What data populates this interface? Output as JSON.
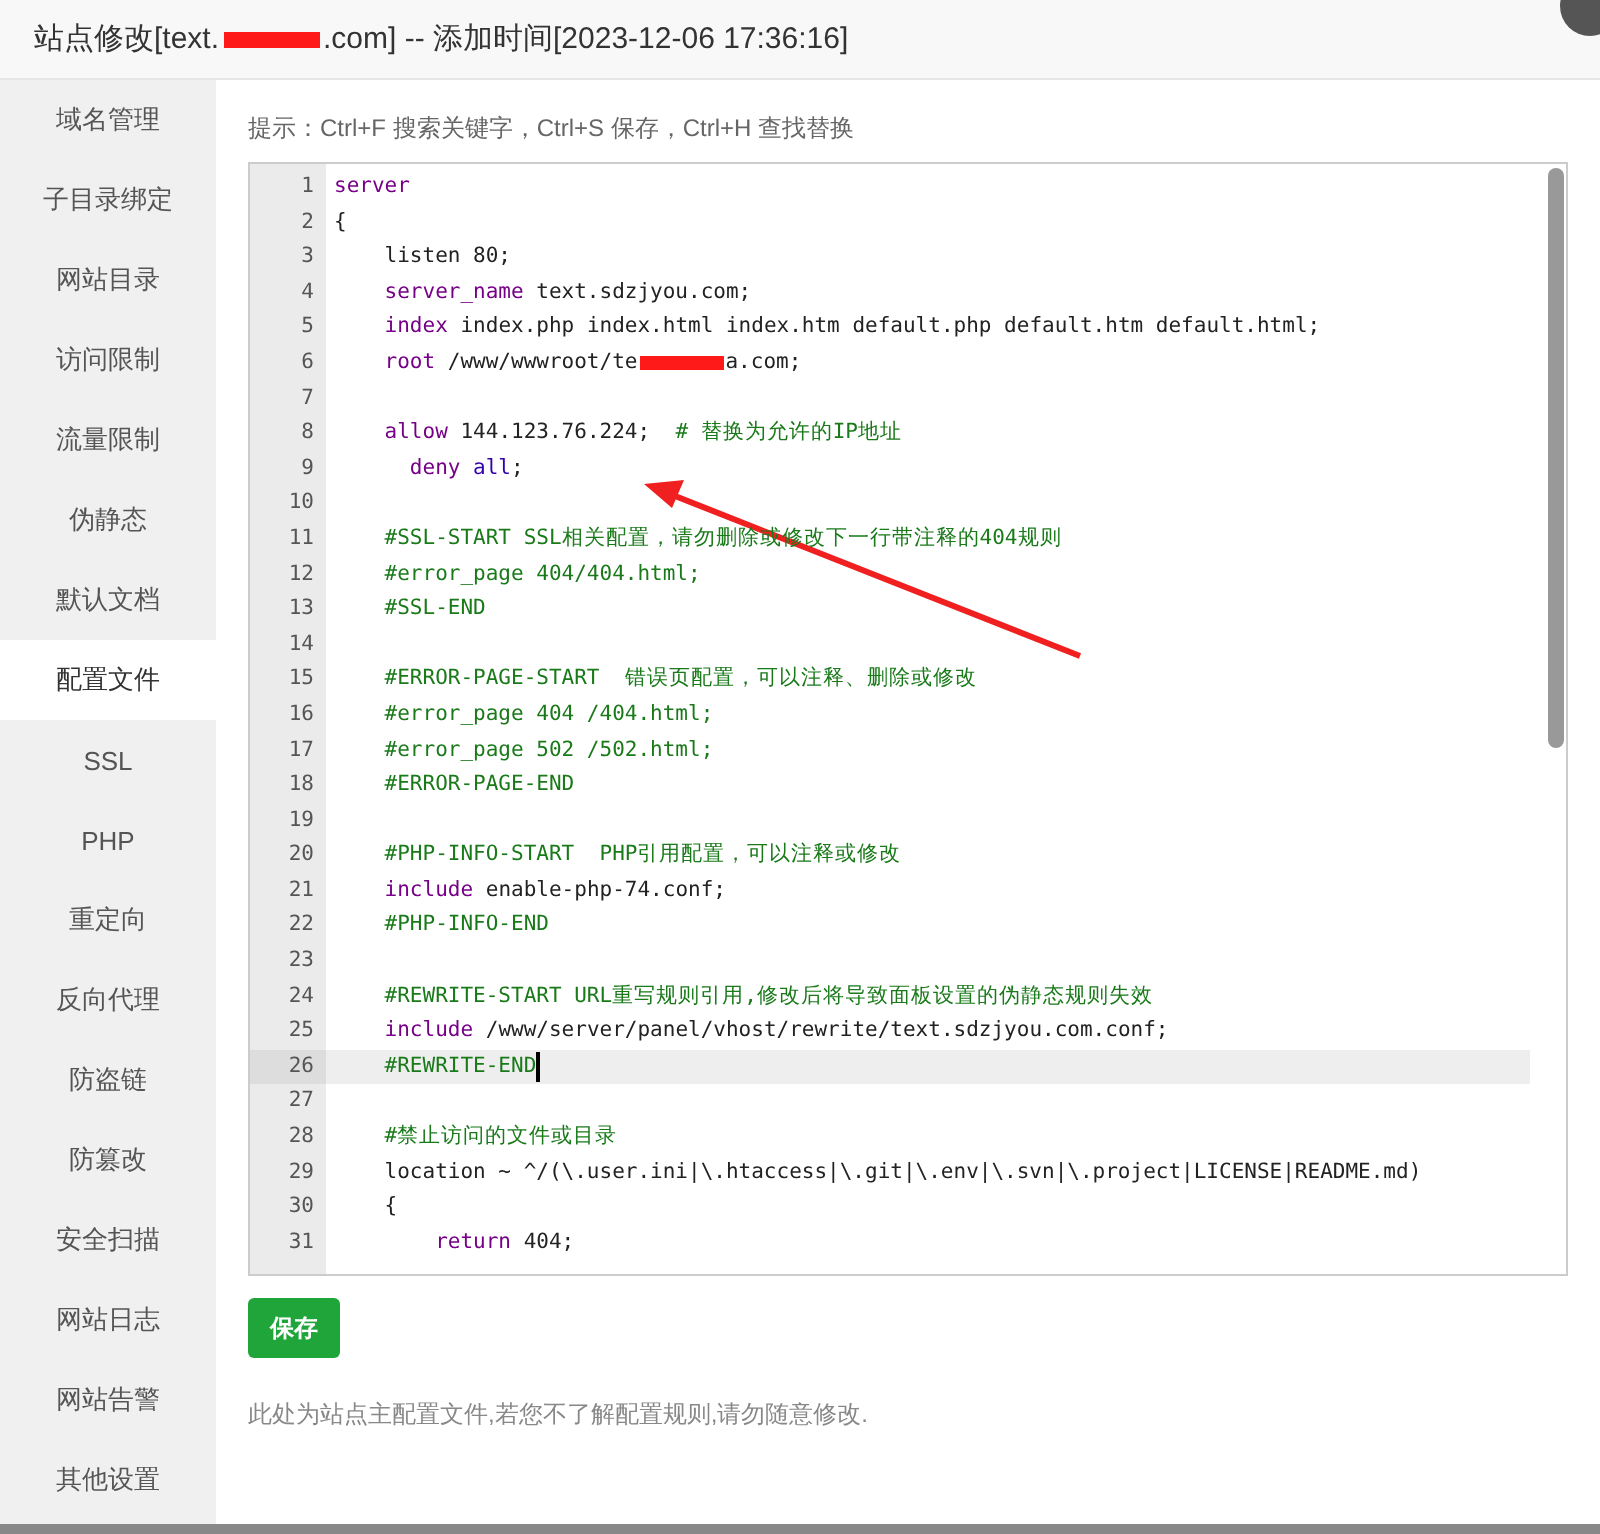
{
  "window": {
    "title_start": "站点修改[text.",
    "title_end": ".com] -- 添加时间[2023-12-06 17:36:16]"
  },
  "sidebar": {
    "items": [
      {
        "label": "域名管理",
        "selected": false
      },
      {
        "label": "子目录绑定",
        "selected": false
      },
      {
        "label": "网站目录",
        "selected": false
      },
      {
        "label": "访问限制",
        "selected": false
      },
      {
        "label": "流量限制",
        "selected": false
      },
      {
        "label": "伪静态",
        "selected": false
      },
      {
        "label": "默认文档",
        "selected": false
      },
      {
        "label": "配置文件",
        "selected": true
      },
      {
        "label": "SSL",
        "selected": false
      },
      {
        "label": "PHP",
        "selected": false
      },
      {
        "label": "重定向",
        "selected": false
      },
      {
        "label": "反向代理",
        "selected": false
      },
      {
        "label": "防盗链",
        "selected": false
      },
      {
        "label": "防篡改",
        "selected": false
      },
      {
        "label": "安全扫描",
        "selected": false
      },
      {
        "label": "网站日志",
        "selected": false
      },
      {
        "label": "网站告警",
        "selected": false
      },
      {
        "label": "其他设置",
        "selected": false
      }
    ]
  },
  "hint": "提示：Ctrl+F 搜索关键字，Ctrl+S 保存，Ctrl+H 查找替换",
  "editor": {
    "lines": [
      {
        "number": "1",
        "current": false,
        "tokens": [
          {
            "kind": "keyword",
            "text": "server"
          }
        ]
      },
      {
        "number": "2",
        "current": false,
        "tokens": [
          {
            "kind": "plain",
            "text": "{"
          }
        ]
      },
      {
        "number": "3",
        "current": false,
        "tokens": [
          {
            "kind": "plain",
            "text": "    listen 80;"
          }
        ]
      },
      {
        "number": "4",
        "current": false,
        "tokens": [
          {
            "kind": "keyword",
            "text": "    server_name"
          },
          {
            "kind": "plain",
            "text": " text.sdzjyou.com;"
          }
        ]
      },
      {
        "number": "5",
        "current": false,
        "tokens": [
          {
            "kind": "keyword",
            "text": "    index"
          },
          {
            "kind": "plain",
            "text": " index.php index.html index.htm default.php default.htm default.html;"
          }
        ]
      },
      {
        "number": "6",
        "current": false,
        "tokens": [
          {
            "kind": "keyword",
            "text": "    root"
          },
          {
            "kind": "plain",
            "text": " /www/wwwroot/te"
          },
          {
            "kind": "redaction"
          },
          {
            "kind": "plain",
            "text": "a.com;"
          }
        ]
      },
      {
        "number": "7",
        "current": false
      },
      {
        "number": "8",
        "current": false,
        "tokens": [
          {
            "kind": "keyword",
            "text": "    allow"
          },
          {
            "kind": "plain",
            "text": " 144.123.76.224;  "
          },
          {
            "kind": "comment",
            "text": "# 替换为允许的IP地址"
          }
        ]
      },
      {
        "number": "9",
        "current": false,
        "tokens": [
          {
            "kind": "keyword",
            "text": "      deny"
          },
          {
            "kind": "atom",
            "text": " all"
          },
          {
            "kind": "plain",
            "text": ";"
          }
        ]
      },
      {
        "number": "10",
        "current": false
      },
      {
        "number": "11",
        "current": false,
        "tokens": [
          {
            "kind": "comment",
            "text": "    #SSL-START SSL相关配置，请勿删除或修改下一行带注释的404规则"
          }
        ]
      },
      {
        "number": "12",
        "current": false,
        "tokens": [
          {
            "kind": "comment",
            "text": "    #error_page 404/404.html;"
          }
        ]
      },
      {
        "number": "13",
        "current": false,
        "tokens": [
          {
            "kind": "comment",
            "text": "    #SSL-END"
          }
        ]
      },
      {
        "number": "14",
        "current": false
      },
      {
        "number": "15",
        "current": false,
        "tokens": [
          {
            "kind": "comment",
            "text": "    #ERROR-PAGE-START  错误页配置，可以注释、删除或修改"
          }
        ]
      },
      {
        "number": "16",
        "current": false,
        "tokens": [
          {
            "kind": "comment",
            "text": "    #error_page 404 /404.html;"
          }
        ]
      },
      {
        "number": "17",
        "current": false,
        "tokens": [
          {
            "kind": "comment",
            "text": "    #error_page 502 /502.html;"
          }
        ]
      },
      {
        "number": "18",
        "current": false,
        "tokens": [
          {
            "kind": "comment",
            "text": "    #ERROR-PAGE-END"
          }
        ]
      },
      {
        "number": "19",
        "current": false
      },
      {
        "number": "20",
        "current": false,
        "tokens": [
          {
            "kind": "comment",
            "text": "    #PHP-INFO-START  PHP引用配置，可以注释或修改"
          }
        ]
      },
      {
        "number": "21",
        "current": false,
        "tokens": [
          {
            "kind": "keyword",
            "text": "    include"
          },
          {
            "kind": "plain",
            "text": " enable-php-74.conf;"
          }
        ]
      },
      {
        "number": "22",
        "current": false,
        "tokens": [
          {
            "kind": "comment",
            "text": "    #PHP-INFO-END"
          }
        ]
      },
      {
        "number": "23",
        "current": false
      },
      {
        "number": "24",
        "current": false,
        "tokens": [
          {
            "kind": "comment",
            "text": "    #REWRITE-START URL重写规则引用,修改后将导致面板设置的伪静态规则失效"
          }
        ]
      },
      {
        "number": "25",
        "current": false,
        "tokens": [
          {
            "kind": "keyword",
            "text": "    include"
          },
          {
            "kind": "plain",
            "text": " /www/server/panel/vhost/rewrite/text.sdzjyou.com.conf;"
          }
        ]
      },
      {
        "number": "26",
        "current": true,
        "tokens": [
          {
            "kind": "comment",
            "text": "    #REWRITE-END"
          }
        ]
      },
      {
        "number": "27",
        "current": false
      },
      {
        "number": "28",
        "current": false,
        "tokens": [
          {
            "kind": "comment",
            "text": "    #禁止访问的文件或目录"
          }
        ]
      },
      {
        "number": "29",
        "current": false,
        "tokens": [
          {
            "kind": "plain",
            "text": "    location ~ ^/(\\.user.ini|\\.htaccess|\\.git|\\.env|\\.svn|\\.project|LICENSE|README.md)"
          }
        ]
      },
      {
        "number": "30",
        "current": false,
        "tokens": [
          {
            "kind": "plain",
            "text": "    {"
          }
        ]
      },
      {
        "number": "31",
        "current": false,
        "tokens": [
          {
            "kind": "keyword",
            "text": "        return"
          },
          {
            "kind": "plain",
            "text": " 404;"
          }
        ]
      }
    ]
  },
  "save_button": "保存",
  "note": "此处为站点主配置文件,若您不了解配置规则,请勿随意修改."
}
